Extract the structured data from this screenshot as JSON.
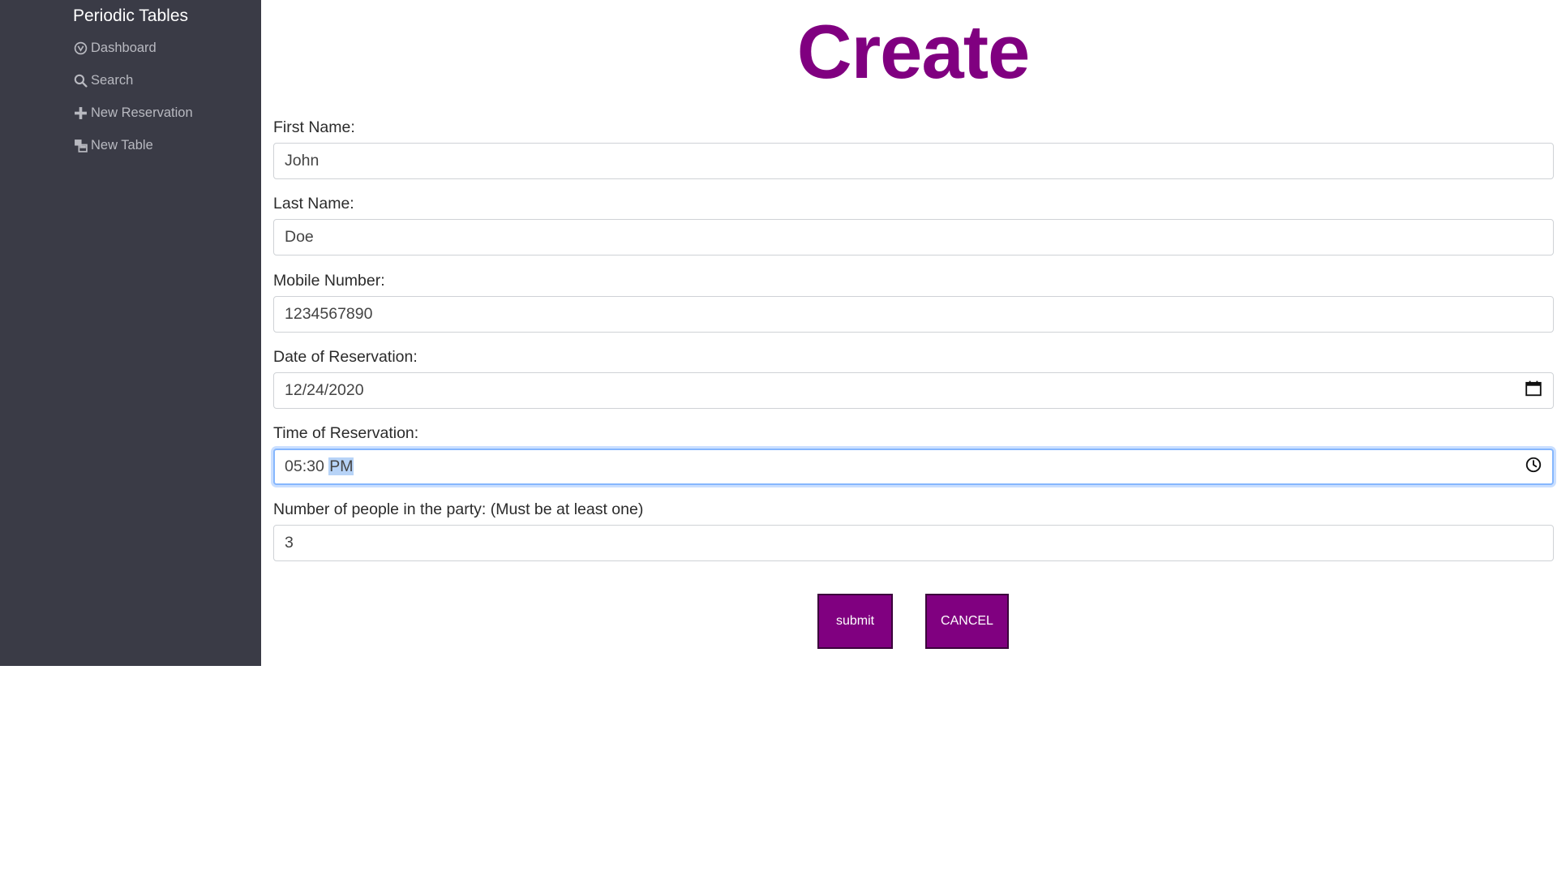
{
  "sidebar": {
    "brand": "Periodic Tables",
    "items": [
      {
        "label": "Dashboard",
        "icon": "dashboard-icon"
      },
      {
        "label": "Search",
        "icon": "search-icon"
      },
      {
        "label": "New Reservation",
        "icon": "plus-icon"
      },
      {
        "label": "New Table",
        "icon": "table-icon"
      }
    ]
  },
  "page": {
    "title": "Create"
  },
  "form": {
    "first_name": {
      "label": "First Name:",
      "value": "John"
    },
    "last_name": {
      "label": "Last Name:",
      "value": "Doe"
    },
    "mobile_number": {
      "label": "Mobile Number:",
      "value": "1234567890"
    },
    "reservation_date": {
      "label": "Date of Reservation:",
      "value": "12/24/2020"
    },
    "reservation_time": {
      "label": "Time of Reservation:",
      "value_time": "05:30",
      "value_period": "PM"
    },
    "people": {
      "label": "Number of people in the party: (Must be at least one)",
      "value": "3"
    }
  },
  "actions": {
    "submit_label": "submit",
    "cancel_label": "CANCEL"
  },
  "colors": {
    "accent": "#800080",
    "sidebar_bg": "#3a3b46",
    "focus_ring": "#86b7fe"
  }
}
